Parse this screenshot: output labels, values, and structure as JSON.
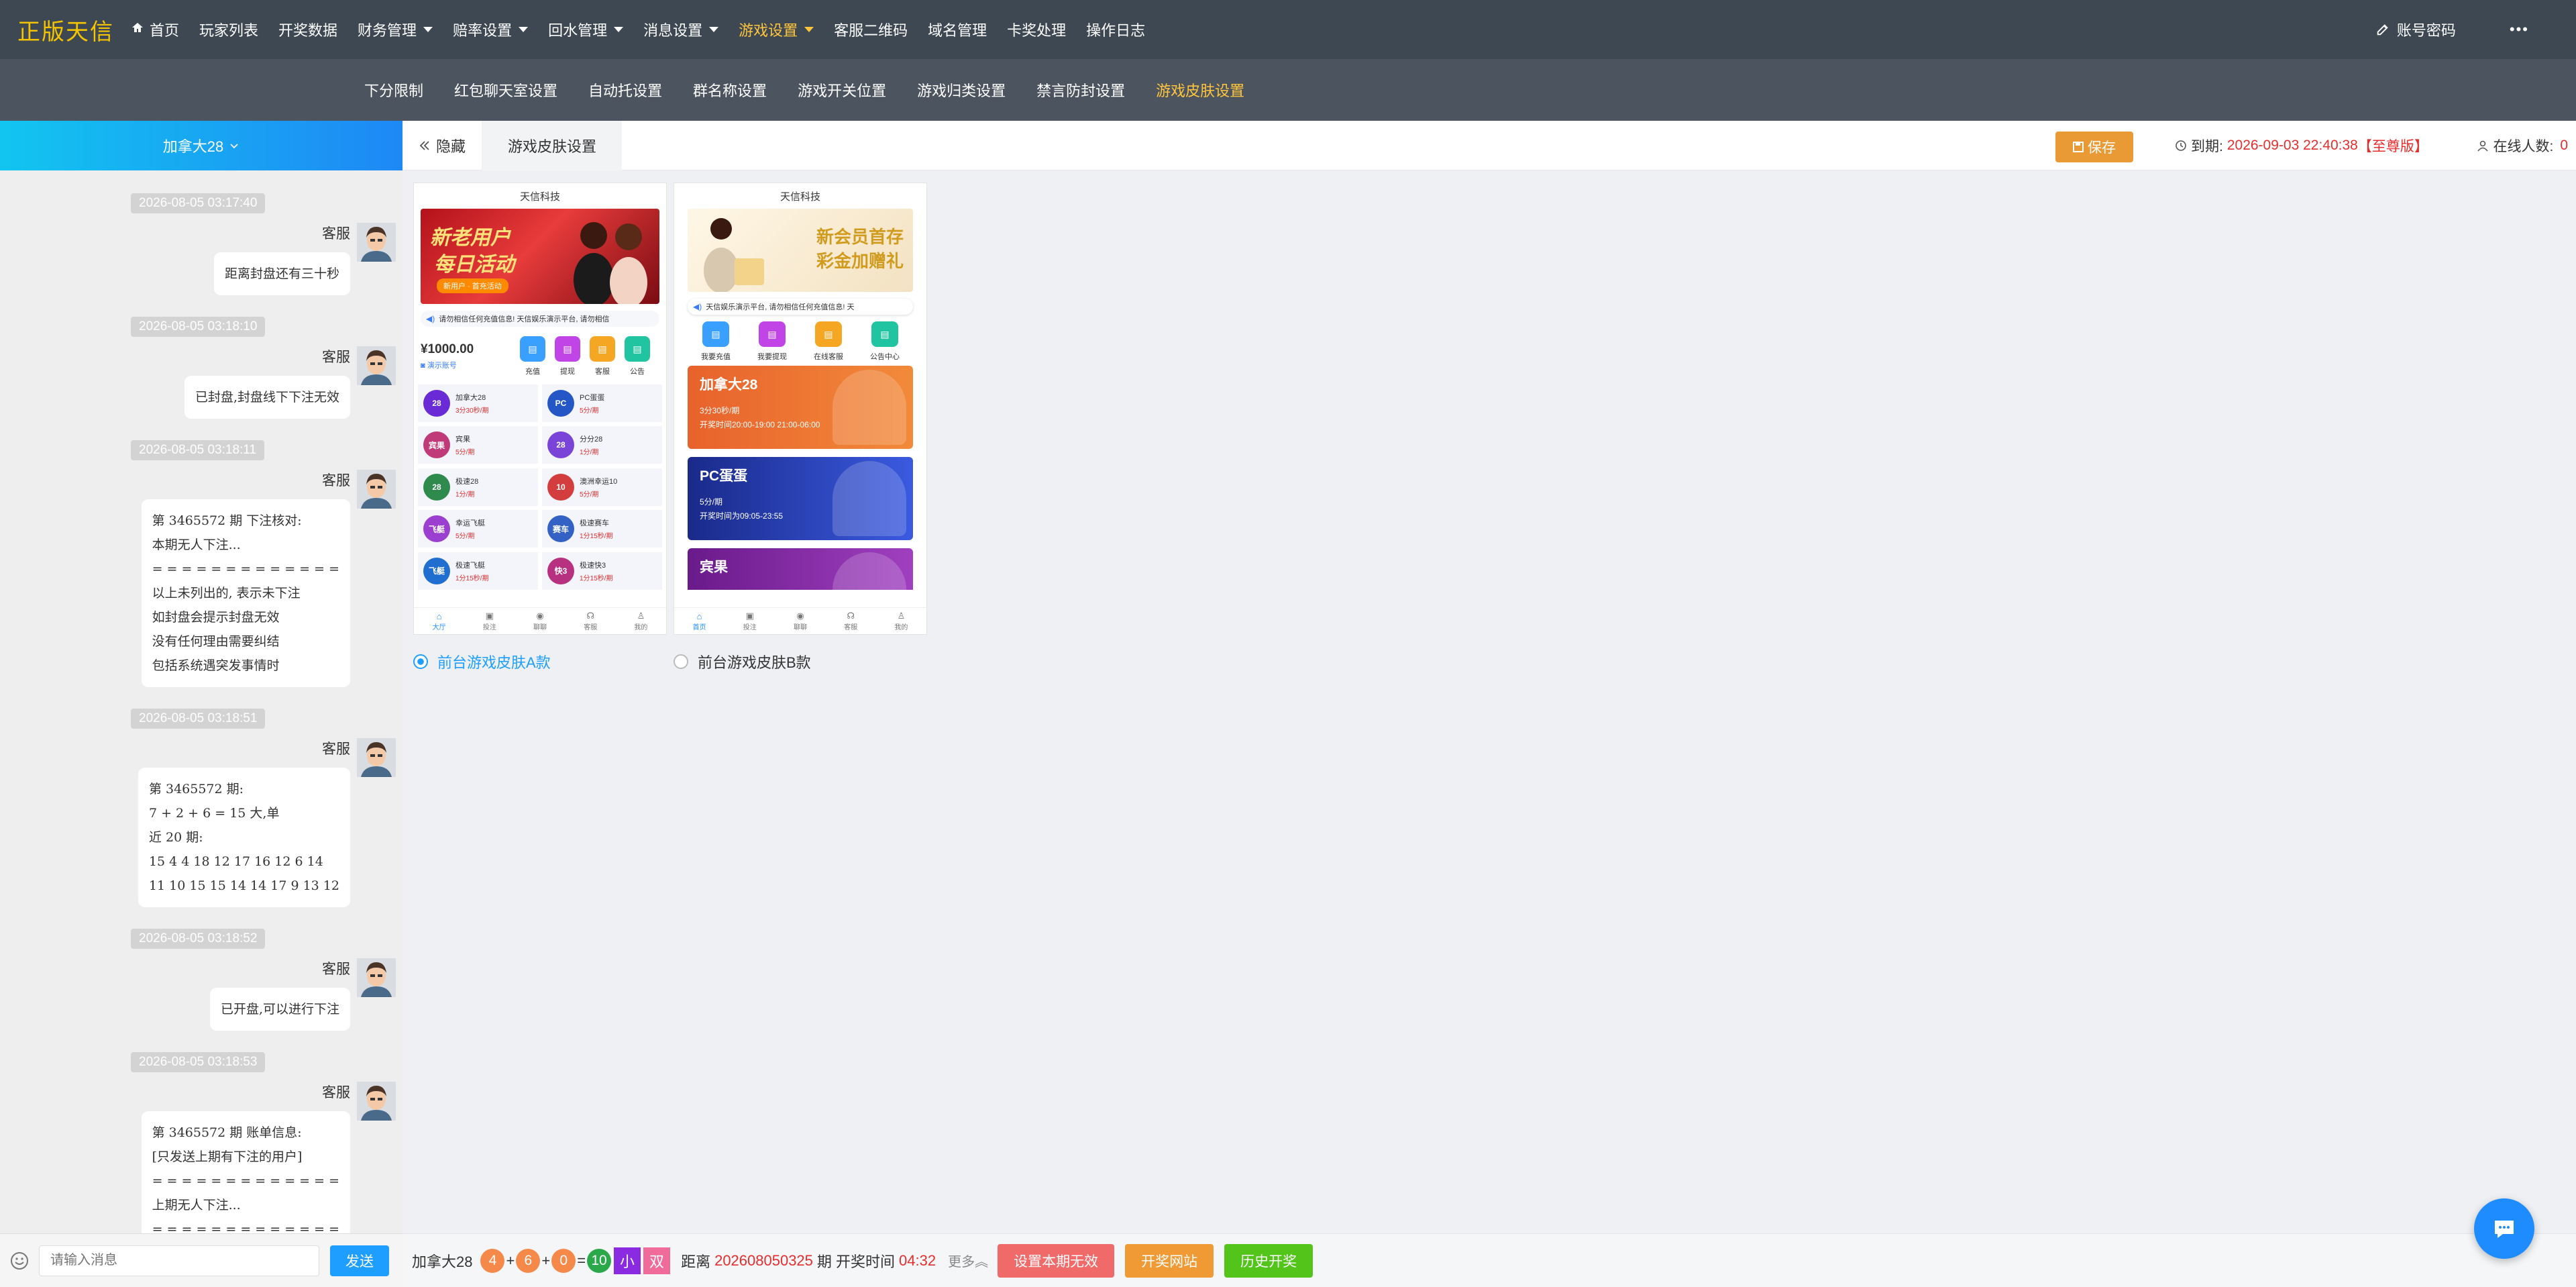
{
  "brand": "正版天信",
  "nav": {
    "items": [
      {
        "label": "首页",
        "dropdown": false,
        "active": false,
        "icon": "home-icon"
      },
      {
        "label": "玩家列表",
        "dropdown": false,
        "active": false
      },
      {
        "label": "开奖数据",
        "dropdown": false,
        "active": false
      },
      {
        "label": "财务管理",
        "dropdown": true,
        "active": false
      },
      {
        "label": "赔率设置",
        "dropdown": true,
        "active": false
      },
      {
        "label": "回水管理",
        "dropdown": true,
        "active": false
      },
      {
        "label": "消息设置",
        "dropdown": true,
        "active": false
      },
      {
        "label": "游戏设置",
        "dropdown": true,
        "active": true
      },
      {
        "label": "客服二维码",
        "dropdown": false,
        "active": false
      },
      {
        "label": "域名管理",
        "dropdown": false,
        "active": false
      },
      {
        "label": "卡奖处理",
        "dropdown": false,
        "active": false
      },
      {
        "label": "操作日志",
        "dropdown": false,
        "active": false
      }
    ],
    "account_label": "账号密码",
    "more_label": "•••",
    "active_color": "#ffc53d"
  },
  "subnav": {
    "items": [
      {
        "label": "下分限制",
        "active": false
      },
      {
        "label": "红包聊天室设置",
        "active": false
      },
      {
        "label": "自动托设置",
        "active": false
      },
      {
        "label": "群名称设置",
        "active": false
      },
      {
        "label": "游戏开关位置",
        "active": false
      },
      {
        "label": "游戏归类设置",
        "active": false
      },
      {
        "label": "禁言防封设置",
        "active": false
      },
      {
        "label": "游戏皮肤设置",
        "active": true
      }
    ]
  },
  "chat": {
    "game_select": "加拿大28",
    "messages": [
      {
        "time": "2026-08-05 03:17:40",
        "sender": "客服",
        "text": "距离封盘还有三十秒"
      },
      {
        "time": "2026-08-05 03:18:10",
        "sender": "客服",
        "text": "已封盘,封盘线下下注无效"
      },
      {
        "time": "2026-08-05 03:18:11",
        "sender": "客服",
        "text": "第 3465572 期 下注核对:\n本期无人下注...\n= = = = = = = = = = = = =\n以上未列出的, 表示未下注\n如封盘会提示封盘无效\n没有任何理由需要纠结\n包括系统遇突发事情时"
      },
      {
        "time": "2026-08-05 03:18:51",
        "sender": "客服",
        "text": "第 3465572 期:\n7 + 2 + 6 = 15 大,单\n近 20 期:\n15 4 4 18 12 17 16 12 6 14\n11 10 15 15 14 14 17 9 13 12"
      },
      {
        "time": "2026-08-05 03:18:52",
        "sender": "客服",
        "text": "已开盘,可以进行下注"
      },
      {
        "time": "2026-08-05 03:18:53",
        "sender": "客服",
        "text": "第 3465572 期 账单信息:\n[只发送上期有下注的用户]\n= = = = = = = = = = = = =\n上期无人下注...\n= = = = = = = = = = = = ="
      }
    ],
    "input_placeholder": "请输入消息",
    "send_label": "发送"
  },
  "toolbar": {
    "hide_label": "隐藏",
    "tab_label": "游戏皮肤设置",
    "save_label": "保存",
    "expire_prefix": "到期:",
    "expire_value": "2026-09-03 22:40:38",
    "expire_level": "【至尊版】",
    "online_label": "在线人数:",
    "online_value": "0"
  },
  "skins": [
    {
      "option_label": "前台游戏皮肤A款",
      "selected": true,
      "company": "天信科技",
      "banner_line1": "新老用户",
      "banner_line2": "每日活动",
      "banner_sub": "新用户 · 首充活动",
      "notice": "请勿相信任何充值信息! 天信娱乐演示平台, 请勿相信",
      "balance": "¥1000.00",
      "account": "演示账号",
      "icons": [
        {
          "label": "充值",
          "color": "#3aa0ff"
        },
        {
          "label": "提现",
          "color": "#c144e6"
        },
        {
          "label": "客服",
          "color": "#f5a623"
        },
        {
          "label": "公告",
          "color": "#20c4a0"
        }
      ],
      "games": [
        {
          "name": "加拿大28",
          "info": "3分30秒/期",
          "logo": "28"
        },
        {
          "name": "PC蛋蛋",
          "info": "5分/期",
          "logo": "PC"
        },
        {
          "name": "宾果",
          "info": "5分/期",
          "logo": "宾果"
        },
        {
          "name": "分分28",
          "info": "1分/期",
          "logo": "28"
        },
        {
          "name": "极速28",
          "info": "1分/期",
          "logo": "28"
        },
        {
          "name": "澳洲幸运10",
          "info": "5分/期",
          "logo": "10"
        },
        {
          "name": "幸运飞艇",
          "info": "5分/期",
          "logo": "飞艇"
        },
        {
          "name": "极速赛车",
          "info": "1分15秒/期",
          "logo": "赛车"
        },
        {
          "name": "极速飞艇",
          "info": "1分15秒/期",
          "logo": "飞艇"
        },
        {
          "name": "极速快3",
          "info": "1分15秒/期",
          "logo": "快3"
        }
      ],
      "tabs": [
        "大厅",
        "投注",
        "聊聊",
        "客服",
        "我的"
      ]
    },
    {
      "option_label": "前台游戏皮肤B款",
      "selected": false,
      "company": "天信科技",
      "banner_line1": "新会员首存",
      "banner_line2": "彩金加赠礼",
      "notice": "天信娱乐演示平台, 请勿相信任何充值信息! 天",
      "icons": [
        {
          "label": "我要充值",
          "color": "#3aa0ff"
        },
        {
          "label": "我要提现",
          "color": "#c144e6"
        },
        {
          "label": "在线客服",
          "color": "#f5a623"
        },
        {
          "label": "公告中心",
          "color": "#20c4a0"
        }
      ],
      "cards": [
        {
          "title": "加拿大28",
          "line1": "3分30秒/期",
          "line2": "开奖时间20:00-19:00 21:00-06:00"
        },
        {
          "title": "PC蛋蛋",
          "line1": "5分/期",
          "line2": "开奖时间为09:05-23:55"
        },
        {
          "title": "宾果",
          "line1": "",
          "line2": ""
        }
      ],
      "tabs": [
        "首页",
        "投注",
        "聊聊",
        "客服",
        "我的"
      ]
    }
  ],
  "bottom": {
    "game": "加拿大28",
    "balls": [
      "4",
      "6",
      "0"
    ],
    "sum": "10",
    "size": "小",
    "parity": "双",
    "distance_label": "距离",
    "period": "202608050325",
    "period_suffix": "期 开奖时间",
    "countdown": "04:32",
    "more_label": "更多",
    "buttons": [
      {
        "label": "设置本期无效",
        "color": "#f06a6a"
      },
      {
        "label": "开奖网站",
        "color": "#f09a35"
      },
      {
        "label": "历史开奖",
        "color": "#52c41a"
      }
    ]
  }
}
